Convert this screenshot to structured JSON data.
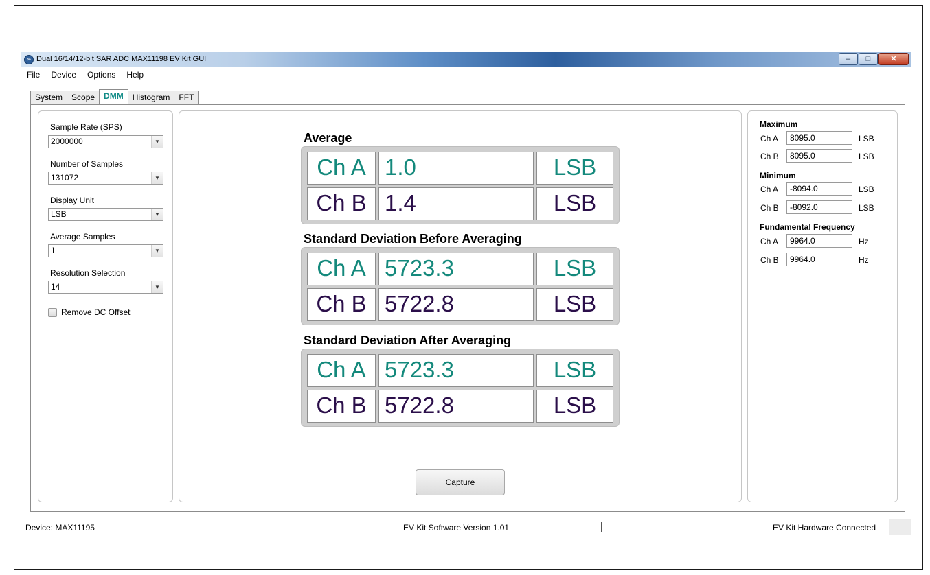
{
  "window": {
    "title": "Dual 16/14/12-bit SAR ADC MAX11198 EV Kit GUI",
    "app_icon_glyph": "∞",
    "minimize_glyph": "–",
    "maximize_glyph": "□",
    "close_glyph": "✕"
  },
  "menu": [
    "File",
    "Device",
    "Options",
    "Help"
  ],
  "tabs": [
    "System",
    "Scope",
    "DMM",
    "Histogram",
    "FFT"
  ],
  "active_tab": "DMM",
  "controls": {
    "sample_rate": {
      "label": "Sample Rate (SPS)",
      "value": "2000000"
    },
    "num_samples": {
      "label": "Number of Samples",
      "value": "131072"
    },
    "display_unit": {
      "label": "Display Unit",
      "value": "LSB"
    },
    "avg_samples": {
      "label": "Average Samples",
      "value": "1"
    },
    "resolution": {
      "label": "Resolution Selection",
      "value": "14"
    },
    "remove_dc": {
      "label": "Remove DC Offset",
      "checked": false
    }
  },
  "stats": {
    "average": {
      "title": "Average",
      "rows": [
        {
          "ch": "Ch A",
          "value": "1.0",
          "unit": "LSB"
        },
        {
          "ch": "Ch B",
          "value": "1.4",
          "unit": "LSB"
        }
      ]
    },
    "std_before": {
      "title": "Standard Deviation Before Averaging",
      "rows": [
        {
          "ch": "Ch A",
          "value": "5723.3",
          "unit": "LSB"
        },
        {
          "ch": "Ch B",
          "value": "5722.8",
          "unit": "LSB"
        }
      ]
    },
    "std_after": {
      "title": "Standard Deviation After Averaging",
      "rows": [
        {
          "ch": "Ch A",
          "value": "5723.3",
          "unit": "LSB"
        },
        {
          "ch": "Ch B",
          "value": "5722.8",
          "unit": "LSB"
        }
      ]
    }
  },
  "capture_label": "Capture",
  "right": {
    "maximum": {
      "title": "Maximum",
      "rows": [
        {
          "ch": "Ch A",
          "value": "8095.0",
          "unit": "LSB"
        },
        {
          "ch": "Ch B",
          "value": "8095.0",
          "unit": "LSB"
        }
      ]
    },
    "minimum": {
      "title": "Minimum",
      "rows": [
        {
          "ch": "Ch A",
          "value": "-8094.0",
          "unit": "LSB"
        },
        {
          "ch": "Ch B",
          "value": "-8092.0",
          "unit": "LSB"
        }
      ]
    },
    "fundamental": {
      "title": "Fundamental Frequency",
      "rows": [
        {
          "ch": "Ch A",
          "value": "9964.0",
          "unit": "Hz"
        },
        {
          "ch": "Ch B",
          "value": "9964.0",
          "unit": "Hz"
        }
      ]
    }
  },
  "status": {
    "device": "Device: MAX11195",
    "version": "EV Kit Software Version 1.01",
    "hardware": "EV Kit Hardware Connected"
  },
  "colors": {
    "channel_a": "#14897c",
    "channel_b": "#2b0f4a",
    "active_tab": "#0f8b86"
  }
}
